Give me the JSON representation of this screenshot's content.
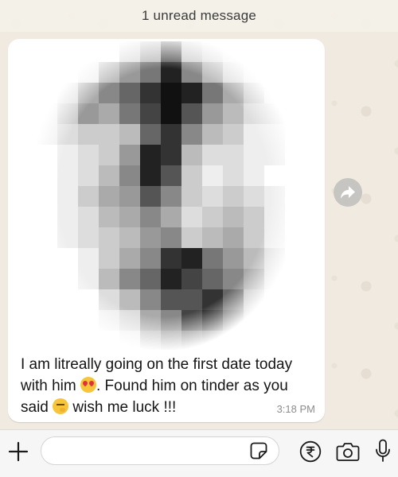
{
  "banner": {
    "unread_text": "1 unread message"
  },
  "message": {
    "text_line1": "I am litreally going on the first date today",
    "text_line2_a": "with him ",
    "text_line2_b": ". Found him on tinder as you",
    "text_line3_a": "said ",
    "text_line3_b": " wish me luck !!!",
    "time": "3:18 PM",
    "emoji_1": "smiling-face-with-heart-eyes-icon",
    "emoji_2": "face-with-crossed-fingers-icon"
  },
  "composer": {
    "input_value": "",
    "input_placeholder": ""
  },
  "icons": {
    "forward": "forward-arrow-icon",
    "attach": "plus-icon",
    "sticker": "sticker-icon",
    "payment": "rupee-icon",
    "camera": "camera-icon",
    "mic": "microphone-icon"
  },
  "colors": {
    "wallpaper": "#f0eae0",
    "bubble": "#ffffff",
    "timestamp": "#8c8c8c",
    "forward_button": "#c7c5c1"
  }
}
